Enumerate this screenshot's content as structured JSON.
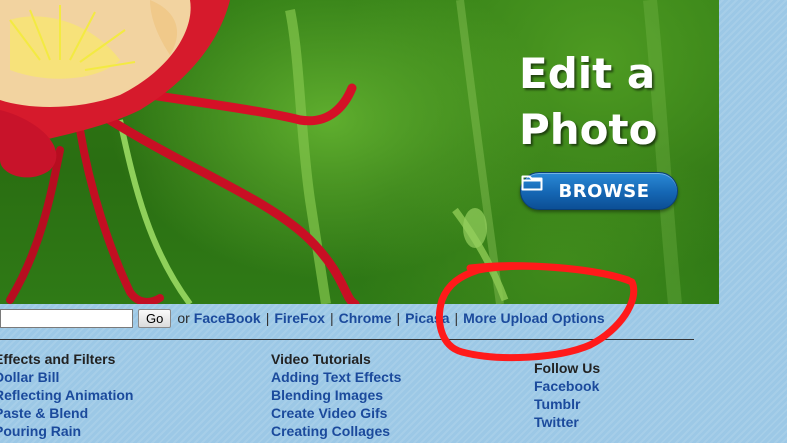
{
  "hero": {
    "title_line1": "Edit a",
    "title_line2": "Photo",
    "browse_label": "BROWSE",
    "browse_icon": "folder-icon"
  },
  "upload_bar": {
    "url_input_value": "",
    "go_label": "Go",
    "or_text": "or",
    "links": [
      "FaceBook",
      "FireFox",
      "Chrome",
      "Picasa",
      "More Upload Options"
    ],
    "separator": "|"
  },
  "footer": {
    "columns": [
      {
        "heading": "Effects and Filters",
        "links": [
          "Dollar Bill",
          "Reflecting Animation",
          "Paste & Blend",
          "Pouring Rain"
        ]
      },
      {
        "heading": "Video Tutorials",
        "links": [
          "Adding Text Effects",
          "Blending Images",
          "Create Video Gifs",
          "Creating Collages"
        ]
      },
      {
        "heading": "Follow Us",
        "links": [
          "Facebook",
          "Tumblr",
          "Twitter"
        ]
      }
    ]
  },
  "colors": {
    "page_background": "#9cc8e6",
    "link": "#1b4a9c",
    "browse_button": "#1566b3",
    "annotation_circle": "#ff1a1a"
  }
}
